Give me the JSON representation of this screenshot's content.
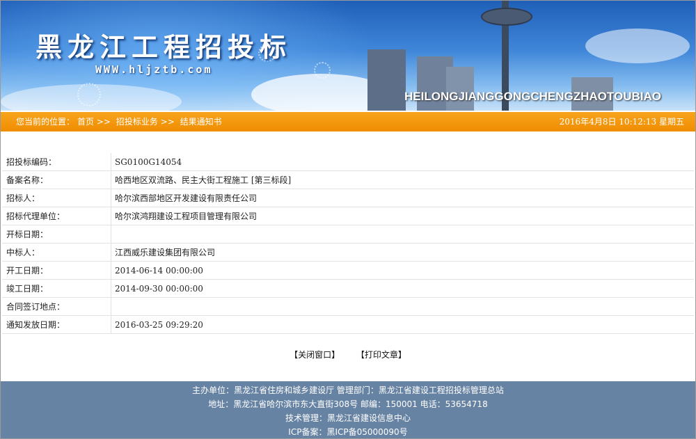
{
  "header": {
    "site_title": "黑龙江工程招投标",
    "site_url": "WWW.hljztb.com",
    "pinyin": "HEILONGJIANGGONGCHENGZHAOTOUBIAO"
  },
  "nav": {
    "location_prefix": "您当前的位置：",
    "crumbs": [
      "首页",
      ">>",
      "招投标业务",
      ">>",
      "结果通知书"
    ],
    "datetime": "2016年4月8日  10:12:13 星期五"
  },
  "info_rows": [
    {
      "label": "招投标编码：",
      "value": "SG0100G14054"
    },
    {
      "label": "备案名称：",
      "value": "哈西地区双流路、民主大街工程施工 [第三标段]"
    },
    {
      "label": "招标人：",
      "value": "哈尔滨西部地区开发建设有限责任公司"
    },
    {
      "label": "招标代理单位：",
      "value": "哈尔滨鸿翔建设工程项目管理有限公司"
    },
    {
      "label": "开标日期：",
      "value": ""
    },
    {
      "label": "中标人：",
      "value": "江西威乐建设集团有限公司"
    },
    {
      "label": "开工日期：",
      "value": "2014-06-14 00:00:00"
    },
    {
      "label": "竣工日期：",
      "value": "2014-09-30 00:00:00"
    },
    {
      "label": "合同签订地点：",
      "value": ""
    },
    {
      "label": "通知发放日期：",
      "value": "2016-03-25 09:29:20"
    }
  ],
  "actions": {
    "close_label": "【关闭窗口】",
    "print_label": "【打印文章】"
  },
  "footer": {
    "line1": "主办单位：黑龙江省住房和城乡建设厅  管理部门：黑龙江省建设工程招投标管理总站",
    "line2": "地址：黑龙江省哈尔滨市东大直街308号  邮编：150001  电话：53654718",
    "line3": "技术管理：黑龙江省建设信息中心",
    "line4": "ICP备案：黑ICP备05000090号"
  },
  "colors": {
    "nav_orange": "#f08c00",
    "footer_blue": "#6783a3",
    "banner_blue": "#1f5fb8"
  }
}
